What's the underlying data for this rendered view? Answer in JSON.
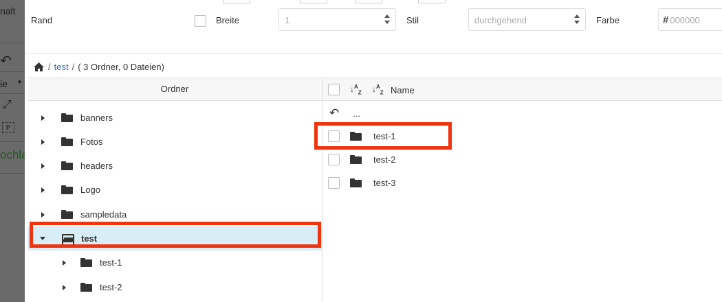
{
  "background": {
    "fragments": [
      "nalt",
      "ie",
      "ochla"
    ],
    "small_box": "P"
  },
  "border_row": {
    "label": "Rand",
    "width_label": "Breite",
    "width_value": "1",
    "style_label": "Stil",
    "style_value": "durchgehend",
    "color_label": "Farbe",
    "color_value": "000000"
  },
  "breadcrumb": {
    "folder": "test",
    "summary": "( 3 Ordner, 0 Dateien)"
  },
  "folder_panel": {
    "header": "Ordner",
    "items": [
      {
        "label": "banners"
      },
      {
        "label": "Fotos"
      },
      {
        "label": "headers"
      },
      {
        "label": "Logo"
      },
      {
        "label": "sampledata"
      },
      {
        "label": "test"
      },
      {
        "label": "test-1"
      },
      {
        "label": "test-2"
      }
    ]
  },
  "file_panel": {
    "header_name": "Name",
    "parent_label": "...",
    "items": [
      {
        "label": "test-1"
      },
      {
        "label": "test-2"
      },
      {
        "label": "test-3"
      }
    ]
  },
  "colors": {
    "selected_row": "#d9edf7",
    "link": "#2a6ebb",
    "highlight": "#f0340f"
  },
  "icons": [
    "home-icon",
    "folder-icon",
    "folder-open-icon",
    "caret-right-icon",
    "caret-down-icon",
    "sort-alpha-asc-icon",
    "sort-alpha-desc-icon",
    "back-arrow-icon",
    "hash-icon",
    "select-arrows-icon"
  ]
}
